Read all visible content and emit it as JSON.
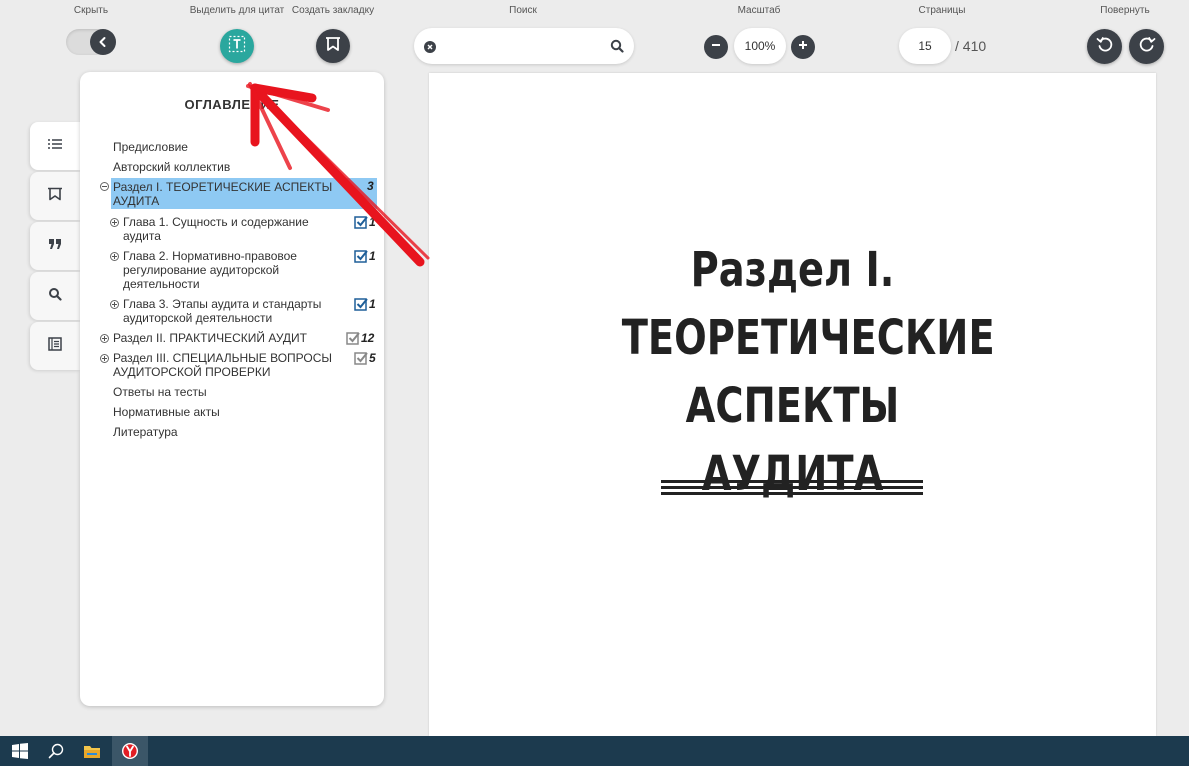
{
  "toolbar": {
    "hide_label": "Скрыть",
    "highlight_label": "Выделить для цитат",
    "bookmark_label": "Создать закладку",
    "search_label": "Поиск",
    "search_value": "",
    "zoom_label": "Масштаб",
    "zoom_value": "100%",
    "pages_label": "Страницы",
    "current_page": "15",
    "page_total": "/ 410",
    "rotate_label": "Повернуть"
  },
  "colors": {
    "accent": "#2aa79e",
    "dark_button": "#3c4148",
    "selected_item": "#8ec9f3",
    "annotation_arrow": "#e8141e",
    "taskbar": "#1c3a4e"
  },
  "sidebar_tabs": [
    {
      "icon": "list-icon",
      "active": true
    },
    {
      "icon": "bookmark-icon",
      "active": false
    },
    {
      "icon": "quote-icon",
      "active": false
    },
    {
      "icon": "search-icon",
      "active": false
    },
    {
      "icon": "notes-icon",
      "active": false
    }
  ],
  "toc": {
    "title": "ОГЛАВЛЕНИЕ",
    "items": [
      {
        "label": "Предисловие"
      },
      {
        "label": "Авторский коллектив"
      },
      {
        "label": "Раздел I. ТЕОРЕТИЧЕСКИЕ АСПЕКТЫ АУДИТА",
        "count": "3",
        "selected": true,
        "expanded": true
      },
      {
        "label": "Глава 1. Сущность и содержание аудита",
        "count": "1"
      },
      {
        "label": "Глава 2. Нормативно-правовое регулирование аудиторской деятельности",
        "count": "1"
      },
      {
        "label": "Глава 3. Этапы аудита и стандарты аудиторской деятельности",
        "count": "1"
      },
      {
        "label": "Раздел II. ПРАКТИЧЕСКИЙ АУДИТ",
        "count": "12"
      },
      {
        "label": "Раздел III. СПЕЦИАЛЬНЫЕ ВОПРОСЫ АУДИТОРСКОЙ ПРОВЕРКИ",
        "count": "5"
      },
      {
        "label": "Ответы на тесты"
      },
      {
        "label": "Нормативные акты"
      },
      {
        "label": "Литература"
      }
    ]
  },
  "document": {
    "heading": "Раздел I. ТЕОРЕТИЧЕСКИЕ АСПЕКТЫ АУДИТА"
  },
  "taskbar": {
    "items": [
      "windows-start-icon",
      "search-icon",
      "file-explorer-icon",
      "yandex-browser-icon"
    ]
  }
}
